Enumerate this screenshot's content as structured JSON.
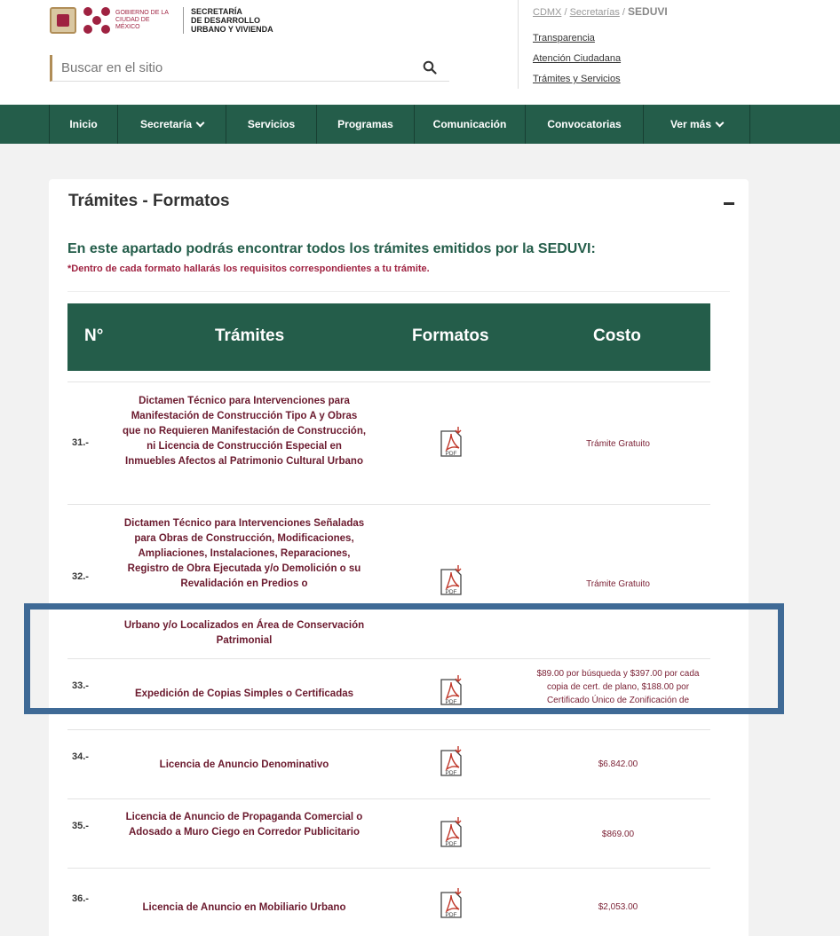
{
  "header": {
    "gov_text": [
      "GOBIERNO DE LA",
      "CIUDAD DE MÉXICO"
    ],
    "secretaria": [
      "SECRETARÍA",
      "DE DESARROLLO",
      "URBANO Y VIVIENDA"
    ],
    "search_placeholder": "Buscar en el sitio",
    "breadcrumb": [
      "CDMX",
      "Secretarías",
      "SEDUVI"
    ],
    "breadcrumb_sep": "/",
    "links": [
      "Transparencia",
      "Atención Ciudadana",
      "Trámites y Servicios"
    ]
  },
  "nav": {
    "items": [
      {
        "label": "Inicio",
        "dropdown": false
      },
      {
        "label": "Secretaría",
        "dropdown": true
      },
      {
        "label": "Servicios",
        "dropdown": false
      },
      {
        "label": "Programas",
        "dropdown": false
      },
      {
        "label": "Comunicación",
        "dropdown": false
      },
      {
        "label": "Convocatorias",
        "dropdown": false
      },
      {
        "label": "Ver más",
        "dropdown": true
      }
    ]
  },
  "card": {
    "title": "Trámites - Formatos",
    "intro_title": "En este apartado podrás encontrar todos los trámites emitidos por la SEDUVI:",
    "intro_note": "*Dentro de cada formato hallarás los requisitos correspondientes a tu trámite."
  },
  "table": {
    "headers": [
      "N°",
      "Trámites",
      "Formatos",
      "Costo"
    ],
    "pdf_label": "PDF",
    "rows": [
      {
        "num": "31.-",
        "tramite": "Dictamen Técnico para Intervenciones para Manifestación de Construcción Tipo A y Obras que no Requieren Manifestación de Construcción, ni Licencia de Construcción Especial en Inmuebles Afectos al Patrimonio Cultural Urbano",
        "costo": "Trámite Gratuito"
      },
      {
        "num": "32.-",
        "tramite_top": "Dictamen Técnico para Intervenciones Señaladas para Obras de Construcción, Modificaciones, Ampliaciones, Instalaciones, Reparaciones, Registro de Obra Ejecutada y/o Demolición o su Revalidación en Predios o",
        "tramite_bottom": "Urbano y/o Localizados en Área de Conservación Patrimonial",
        "costo": "Trámite Gratuito"
      },
      {
        "num": "33.-",
        "tramite": "Expedición de Copias Simples o Certificadas",
        "costo": "$89.00 por búsqueda y $397.00 por cada copia de cert. de plano, $188.00 por Certificado Único de Zonificación de"
      },
      {
        "num": "34.-",
        "tramite": "Licencia de Anuncio Denominativo",
        "costo": "$6.842.00"
      },
      {
        "num": "35.-",
        "tramite": "Licencia de Anuncio de Propaganda Comercial o Adosado a Muro Ciego en Corredor Publicitario",
        "costo": "$869.00"
      },
      {
        "num": "36.-",
        "tramite": "Licencia de Anuncio en Mobiliario Urbano",
        "costo": "$2,053.00"
      }
    ]
  },
  "colors": {
    "nav_green": "#245d4a",
    "brand_maroon": "#9f2241",
    "gold": "#b08d57",
    "highlight_blue": "#3f6a96"
  }
}
